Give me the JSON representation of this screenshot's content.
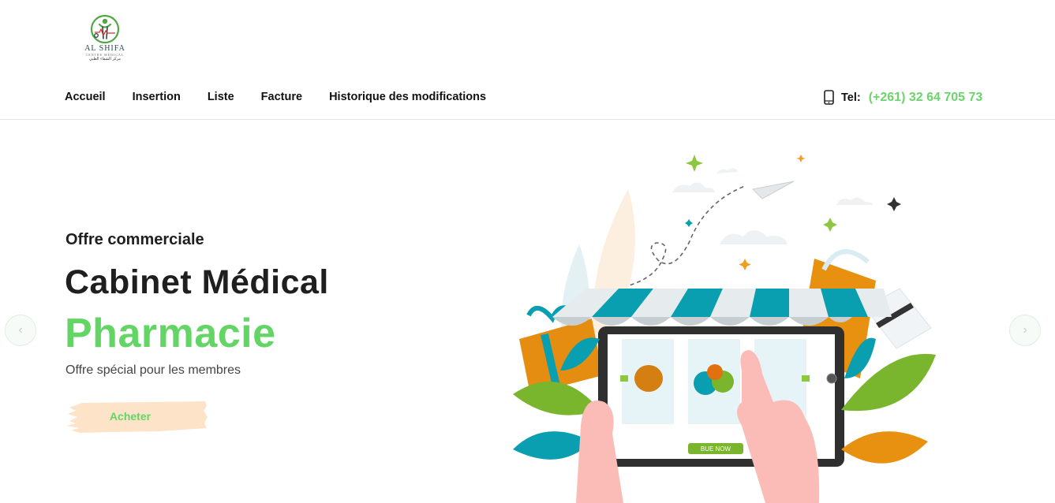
{
  "logo": {
    "name": "AL SHIFA",
    "subtitle": "CENTRE MEDICAL",
    "arabic": "مركز الشفاء الطبي"
  },
  "nav": {
    "items": [
      {
        "label": "Accueil"
      },
      {
        "label": "Insertion"
      },
      {
        "label": "Liste"
      },
      {
        "label": "Facture"
      },
      {
        "label": "Historique des modifications"
      }
    ]
  },
  "contact": {
    "icon": "phone-icon",
    "label": "Tel:",
    "number": "(+261) 32 64 705 73"
  },
  "hero": {
    "eyebrow": "Offre commerciale",
    "title": "Cabinet Médical",
    "subtitle": "Pharmacie",
    "tagline": "Offre spécial pour les membres",
    "cta_label": "Acheter",
    "prev_icon": "chevron-left-icon",
    "next_icon": "chevron-right-icon",
    "illustration_button": "BUE NOW"
  },
  "colors": {
    "accent_green": "#62d565",
    "cta_background": "#fde3c8",
    "awning_teal": "#0a9fb0",
    "text_dark": "#1f1f1f"
  }
}
